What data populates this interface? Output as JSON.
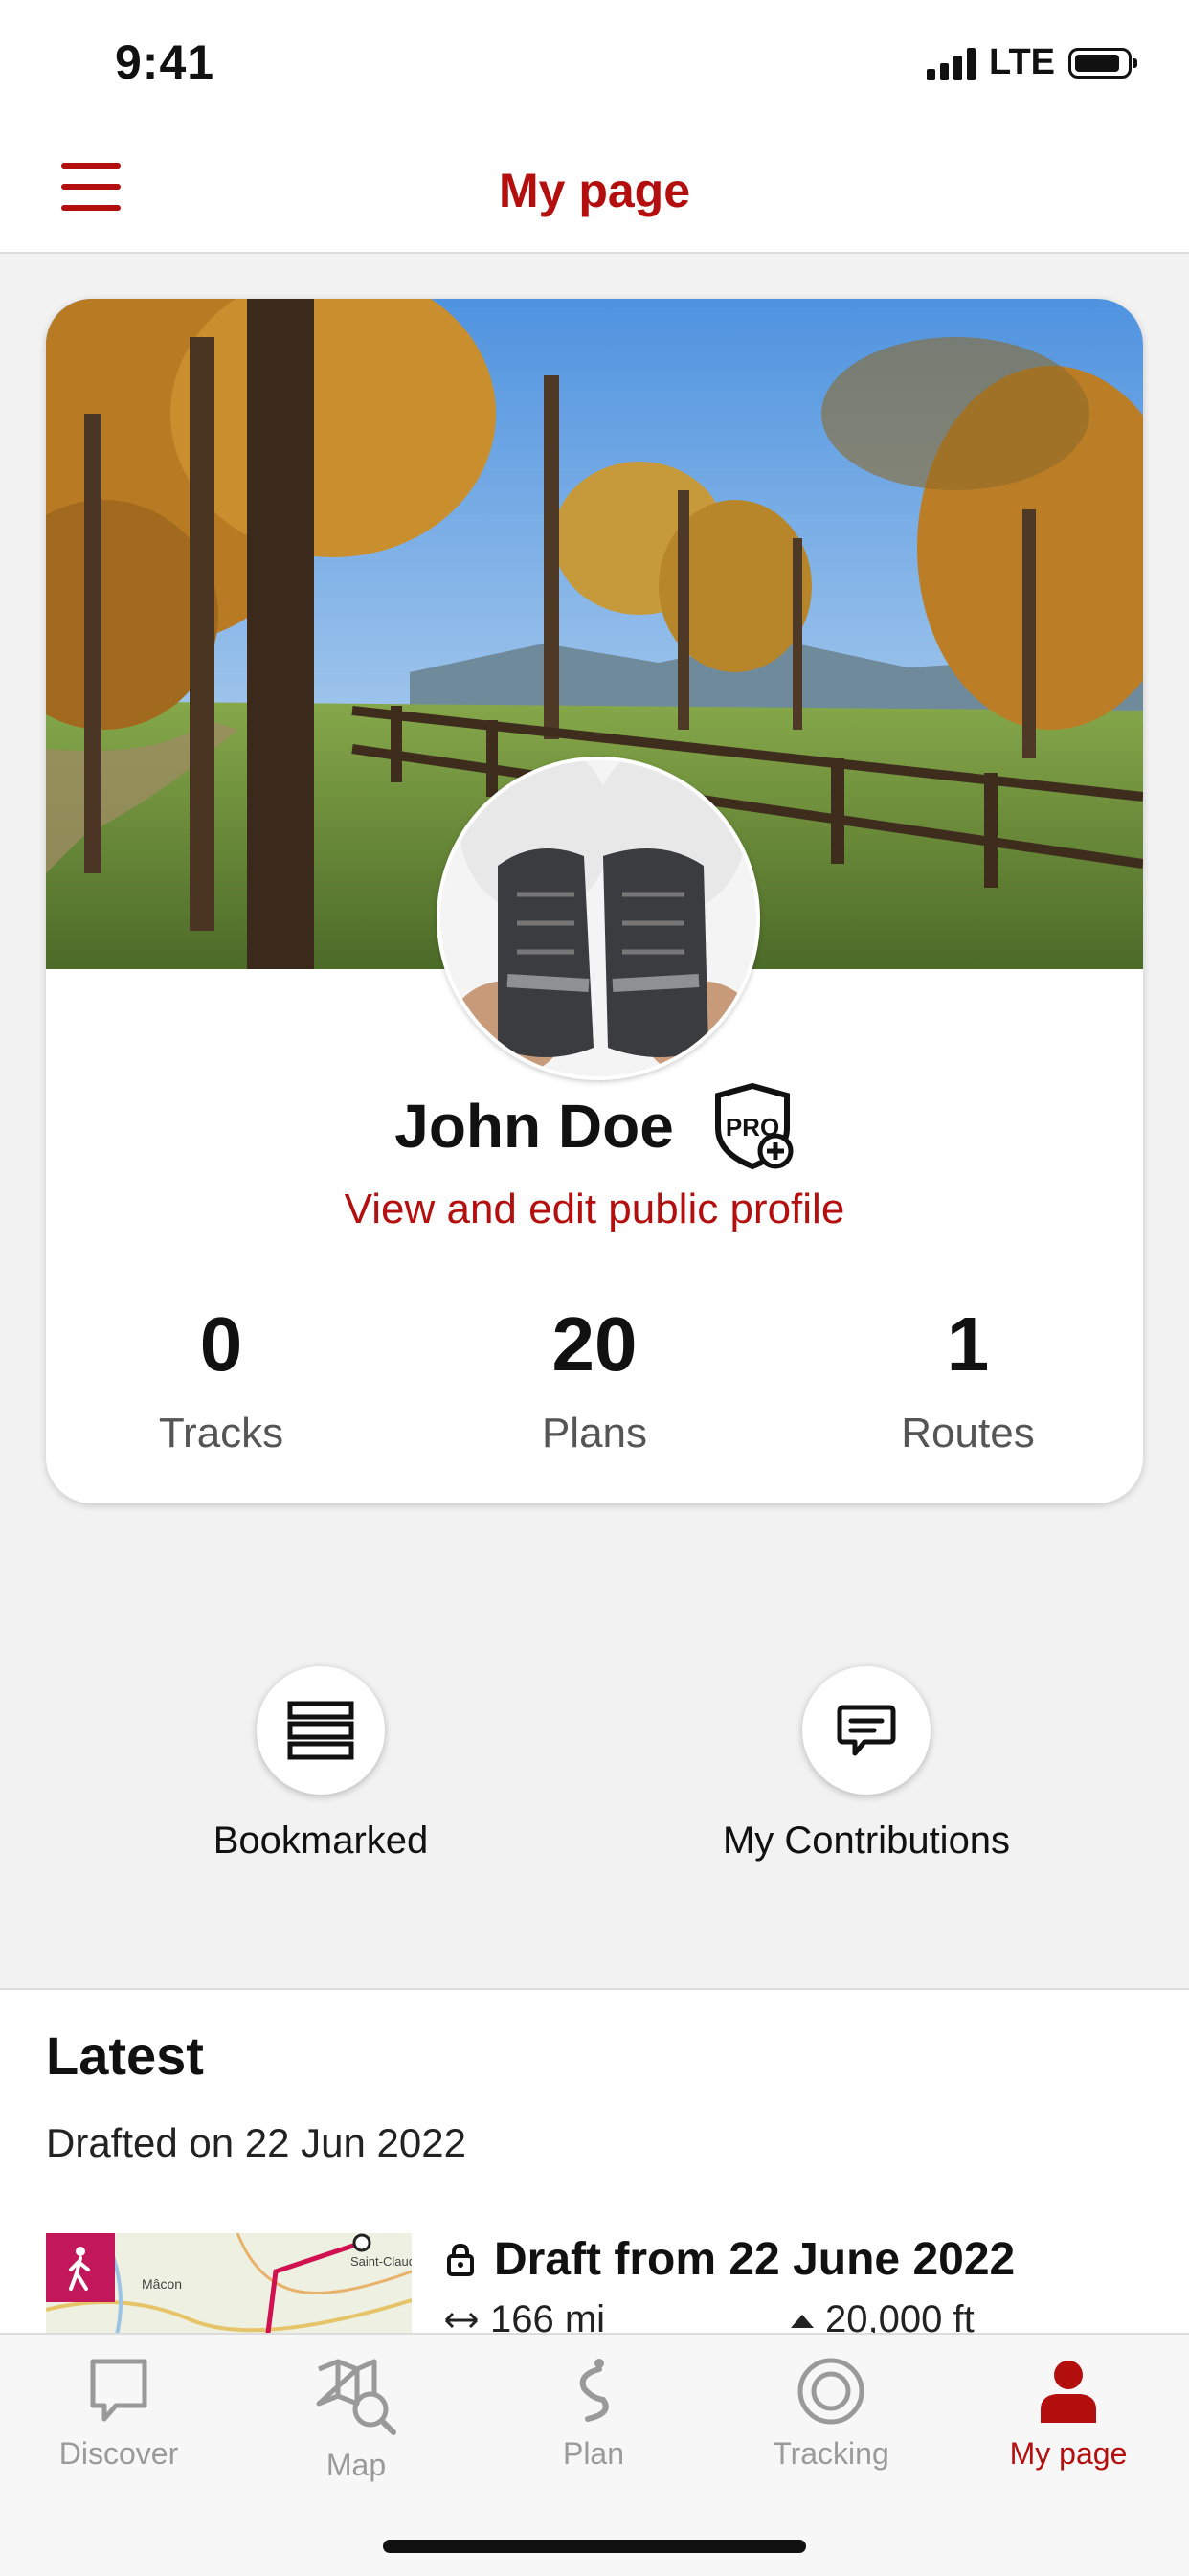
{
  "status_bar": {
    "time": "9:41",
    "network": "LTE"
  },
  "header": {
    "title": "My page",
    "menu_icon": "hamburger-menu-icon"
  },
  "profile": {
    "name": "John Doe",
    "badge_icon": "pro-plus-badge-icon",
    "edit_link": "View and edit public profile",
    "stats": [
      {
        "value": "0",
        "label": "Tracks"
      },
      {
        "value": "20",
        "label": "Plans"
      },
      {
        "value": "1",
        "label": "Routes"
      }
    ]
  },
  "actions": [
    {
      "label": "Bookmarked",
      "icon": "bookmark-list-icon"
    },
    {
      "label": "My Contributions",
      "icon": "comment-icon"
    }
  ],
  "latest": {
    "title": "Latest",
    "subtitle": "Drafted on 22 Jun 2022",
    "item": {
      "title": "Draft from 22 June 2022",
      "distance": "166 mi",
      "elevation": "20,000 ft",
      "map_labels": [
        "Mâcon",
        "Saint-Claude"
      ]
    }
  },
  "tabs": [
    {
      "label": "Discover",
      "icon": "discover-icon",
      "active": false
    },
    {
      "label": "Map",
      "icon": "map-icon",
      "active": false
    },
    {
      "label": "Plan",
      "icon": "plan-icon",
      "active": false
    },
    {
      "label": "Tracking",
      "icon": "tracking-icon",
      "active": false
    },
    {
      "label": "My page",
      "icon": "user-icon",
      "active": true
    }
  ],
  "colors": {
    "accent": "#b40f0f",
    "walk_badge": "#c2185b"
  }
}
